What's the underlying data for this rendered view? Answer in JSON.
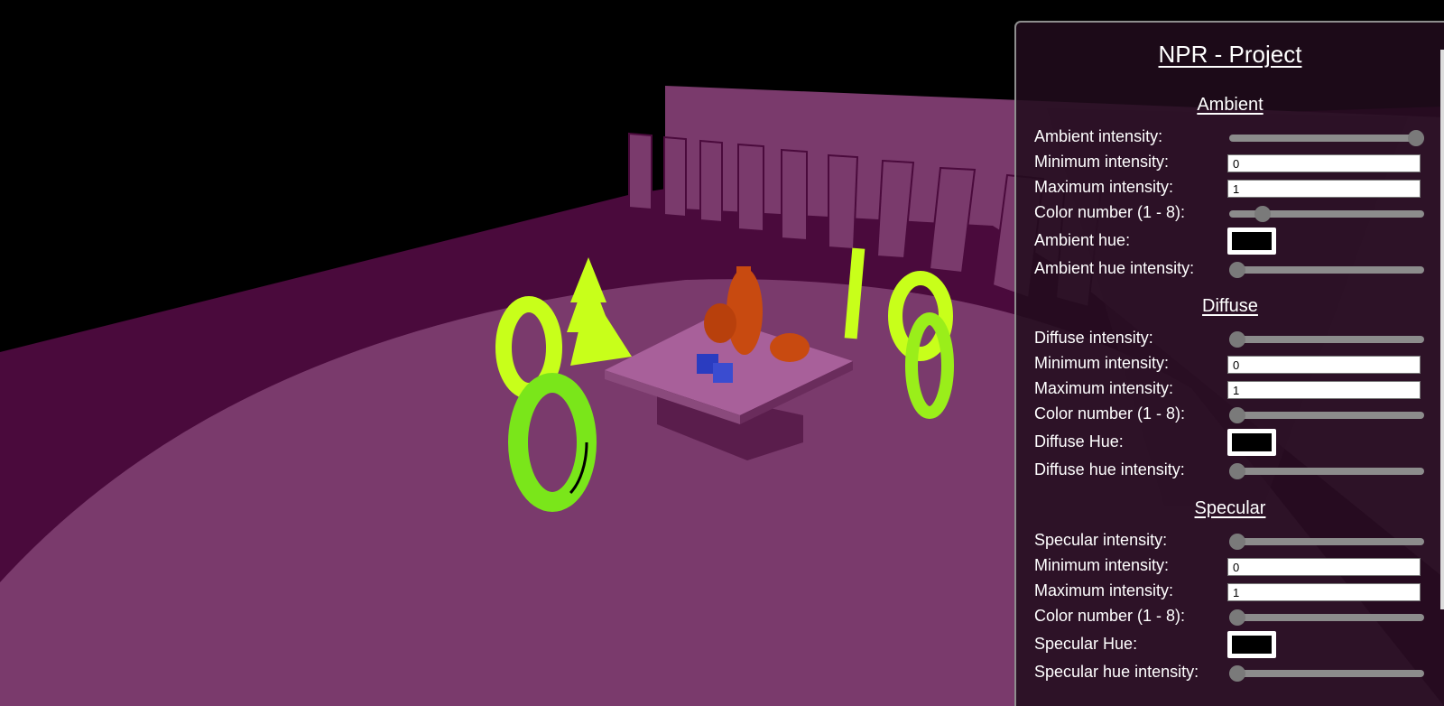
{
  "title": "NPR - Project",
  "sections": [
    {
      "heading": "Ambient",
      "controls": [
        {
          "label": "Ambient intensity:",
          "type": "slider",
          "value": 1.0
        },
        {
          "label": "Minimum intensity:",
          "type": "number",
          "value": "0"
        },
        {
          "label": "Maximum intensity:",
          "type": "number",
          "value": "1"
        },
        {
          "label": "Color number (1 - 8):",
          "type": "slider",
          "value": 0.14
        },
        {
          "label": "Ambient hue:",
          "type": "color",
          "value": "#000000"
        },
        {
          "label": "Ambient hue intensity:",
          "type": "slider",
          "value": 0.0
        }
      ]
    },
    {
      "heading": "Diffuse",
      "controls": [
        {
          "label": "Diffuse intensity:",
          "type": "slider",
          "value": 0.0
        },
        {
          "label": "Minimum intensity:",
          "type": "number",
          "value": "0"
        },
        {
          "label": "Maximum intensity:",
          "type": "number",
          "value": "1"
        },
        {
          "label": "Color number (1 - 8):",
          "type": "slider",
          "value": 0.0
        },
        {
          "label": "Diffuse Hue:",
          "type": "color",
          "value": "#000000"
        },
        {
          "label": "Diffuse hue intensity:",
          "type": "slider",
          "value": 0.0
        }
      ]
    },
    {
      "heading": "Specular",
      "controls": [
        {
          "label": "Specular intensity:",
          "type": "slider",
          "value": 0.0
        },
        {
          "label": "Minimum intensity:",
          "type": "number",
          "value": "0"
        },
        {
          "label": "Maximum intensity:",
          "type": "number",
          "value": "1"
        },
        {
          "label": "Color number (1 - 8):",
          "type": "slider",
          "value": 0.0
        },
        {
          "label": "Specular Hue:",
          "type": "color",
          "value": "#000000"
        },
        {
          "label": "Specular hue intensity:",
          "type": "slider",
          "value": 0.0
        }
      ]
    }
  ],
  "colors": {
    "floor": "#7a3a6c",
    "wall": "#4a0a3c",
    "fence": "#7a3a6c",
    "accent": "#c8ff1a",
    "orange": "#c84a10",
    "blue": "#2a3cc0"
  }
}
